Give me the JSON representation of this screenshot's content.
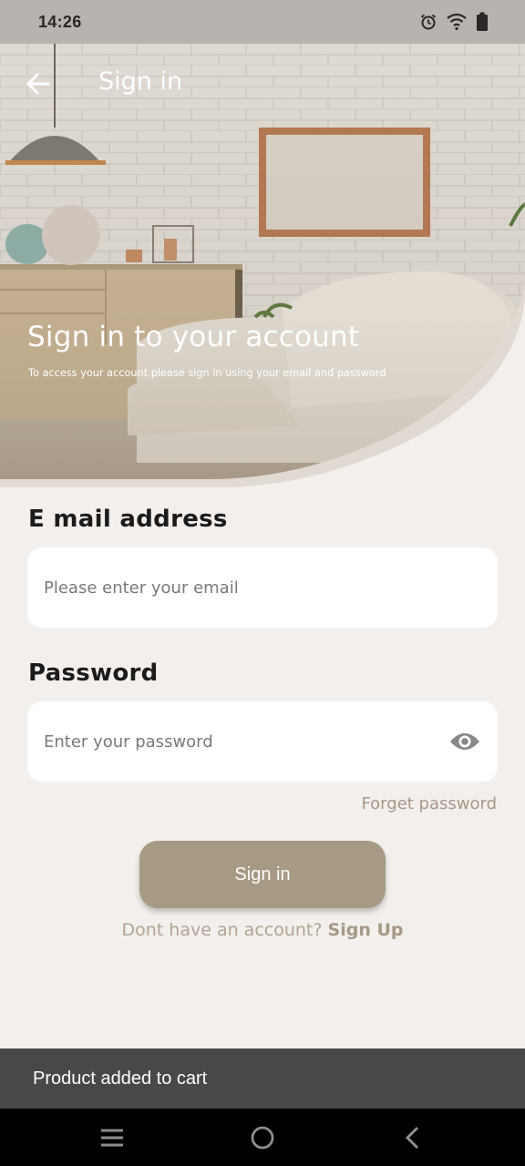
{
  "status_bar": {
    "time": "14:26",
    "icons": [
      "alarm-icon",
      "wifi-icon",
      "battery-icon"
    ]
  },
  "app_bar": {
    "back_icon": "arrow-left-icon",
    "title": "Sign in"
  },
  "hero": {
    "heading": "Sign in to your account",
    "subtitle": "To access your account please sign in using your email and password"
  },
  "form": {
    "email": {
      "label": "E mail address",
      "value": "",
      "placeholder": "Please enter your email"
    },
    "password": {
      "label": "Password",
      "value": "",
      "placeholder": "Enter your password",
      "toggle_icon": "eye-icon"
    },
    "forget_password": "Forget password",
    "submit_label": "Sign in",
    "signup_prompt": "Dont have an account?",
    "signup_link": "Sign Up"
  },
  "snackbar": {
    "message": "Product added to cart"
  },
  "nav_bar": {
    "icons": [
      "menu-icon",
      "home-icon",
      "back-icon"
    ]
  },
  "colors": {
    "accent": "#a69a84",
    "link": "#a69987",
    "background": "#f2efec",
    "snackbar": "#48474a"
  }
}
